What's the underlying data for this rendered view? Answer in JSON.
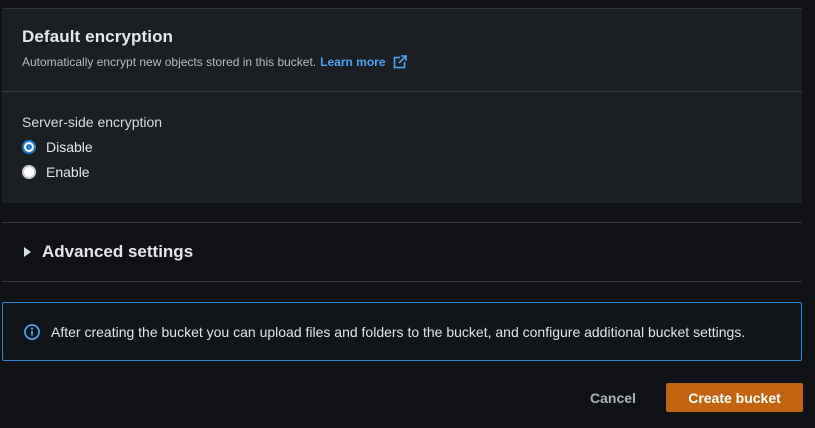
{
  "encryption": {
    "title": "Default encryption",
    "description": "Automatically encrypt new objects stored in this bucket.",
    "learn_more": "Learn more",
    "learn_more_icon": "external-link-icon",
    "field_label": "Server-side encryption",
    "options": [
      {
        "label": "Disable",
        "selected": true
      },
      {
        "label": "Enable",
        "selected": false
      }
    ]
  },
  "advanced": {
    "title": "Advanced settings",
    "icon": "caret-right-icon",
    "expanded": false
  },
  "info": {
    "icon": "info-icon",
    "text": "After creating the bucket you can upload files and folders to the bucket, and configure additional bucket settings."
  },
  "actions": {
    "cancel_label": "Cancel",
    "create_label": "Create bucket"
  },
  "colors": {
    "link": "#4ea3f5",
    "primary_button": "#c2630f",
    "radio_selected": "#1f7bd8",
    "info_border": "#2f86d6",
    "panel_bg": "#1b1e22",
    "page_bg": "#0f1114"
  }
}
